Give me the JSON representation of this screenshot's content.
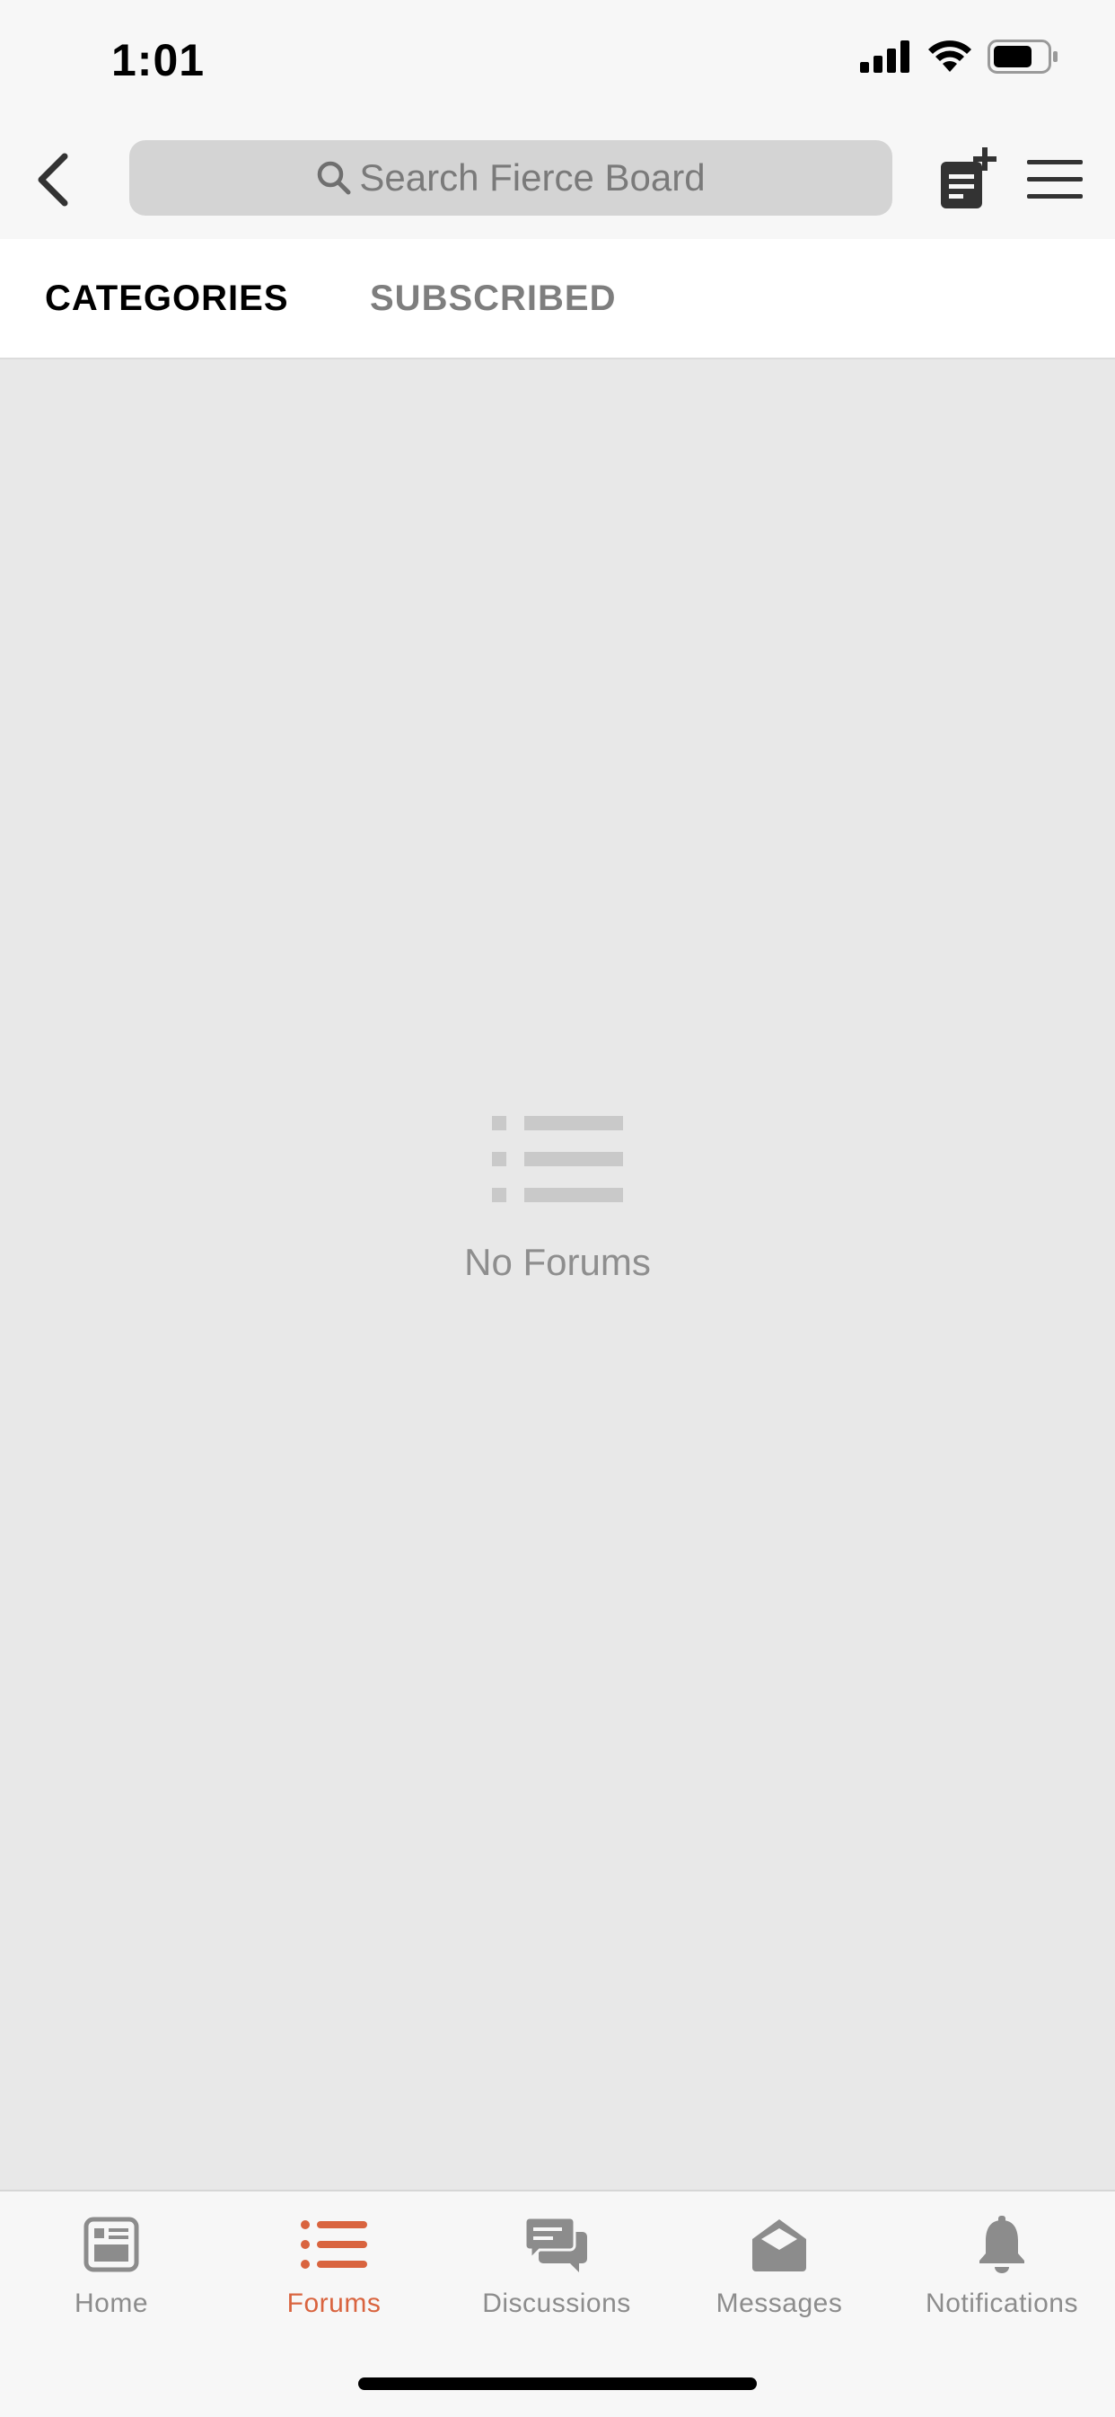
{
  "status_bar": {
    "time": "1:01",
    "icons": [
      "signal-icon",
      "wifi-icon",
      "battery-icon"
    ]
  },
  "nav": {
    "back_icon": "chevron-left-icon",
    "search_placeholder": "Search Fierce Board",
    "compose_icon": "new-post-icon",
    "menu_icon": "hamburger-menu-icon"
  },
  "tabs": [
    {
      "label": "CATEGORIES",
      "active": true
    },
    {
      "label": "SUBSCRIBED",
      "active": false
    }
  ],
  "empty_state": {
    "icon": "list-icon",
    "message": "No Forums"
  },
  "tab_bar": {
    "items": [
      {
        "label": "Home",
        "icon": "home-icon",
        "active": false
      },
      {
        "label": "Forums",
        "icon": "list-icon",
        "active": true
      },
      {
        "label": "Discussions",
        "icon": "chat-bubbles-icon",
        "active": false
      },
      {
        "label": "Messages",
        "icon": "envelope-open-icon",
        "active": false
      },
      {
        "label": "Notifications",
        "icon": "bell-icon",
        "active": false
      }
    ]
  },
  "colors": {
    "accent": "#d9643f",
    "inactive": "#8c8c8c",
    "content_background": "#e8e8e8",
    "bar_background": "#f7f7f7"
  }
}
